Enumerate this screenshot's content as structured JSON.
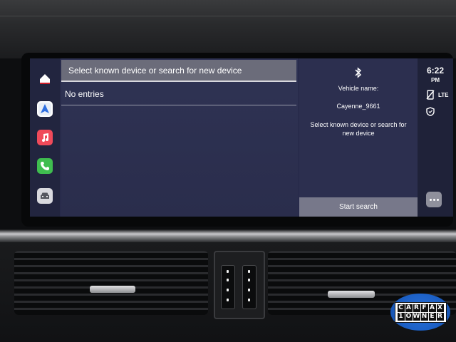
{
  "list": {
    "header": "Select known device or search for new device",
    "items": [
      "No entries"
    ]
  },
  "info": {
    "vehicle_name_label": "Vehicle name:",
    "vehicle_name": "Cayenne_9661",
    "instruction": "Select known device or search for new device",
    "start_search": "Start search"
  },
  "status": {
    "time": "6:22",
    "ampm": "PM",
    "network": "LTE"
  },
  "badge": {
    "line1": "CARFAX",
    "line2": "1OWNER"
  },
  "icons": [
    "home-icon",
    "navigation-icon",
    "music-icon",
    "phone-icon",
    "car-icon",
    "bluetooth-icon",
    "no-phone-icon",
    "shield-icon",
    "more-icon"
  ],
  "colors": {
    "screen_bg": "#282b4b",
    "header_bg": "#6b6c7a",
    "button_bg": "#77788a"
  }
}
